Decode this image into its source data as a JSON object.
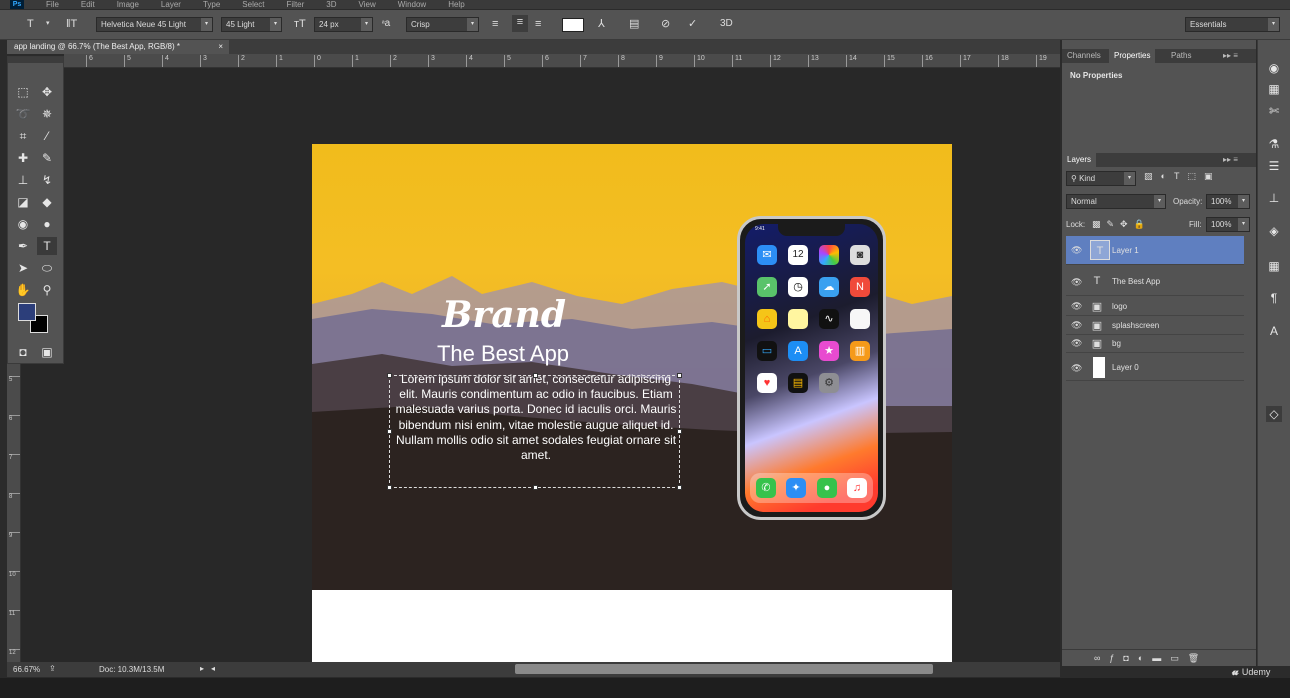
{
  "menubar": {
    "items": [
      "File",
      "Edit",
      "Image",
      "Layer",
      "Type",
      "Select",
      "Filter",
      "3D",
      "View",
      "Window",
      "Help"
    ]
  },
  "options": {
    "font_family": "Helvetica Neue 45 Light",
    "font_style": "45 Light",
    "font_size": "24 px",
    "aa_label": "a",
    "antialias": "Crisp",
    "three_d": "3D",
    "workspace": "Essentials"
  },
  "document": {
    "tab_title": "app landing @ 66.7% (The Best App, RGB/8) *",
    "close": "×"
  },
  "ruler_ticks": [
    "6",
    "5",
    "4",
    "3",
    "2",
    "1",
    "0",
    "1",
    "2",
    "3",
    "4",
    "5",
    "6",
    "7",
    "8",
    "9",
    "10",
    "11",
    "12",
    "13",
    "14",
    "15",
    "16",
    "17",
    "18",
    "19"
  ],
  "ruler_v_ticks": [
    "5",
    "6",
    "7",
    "8",
    "9",
    "10",
    "11",
    "12",
    "13"
  ],
  "canvas": {
    "brand": "Brand",
    "headline": "The Best App",
    "body_lines": [
      "Lorem ipsum dolor sit amet, consectetur adipiscing",
      "elit. Mauris condimentum ac odio in faucibus. Etiam",
      "malesuada varius porta. Donec id iaculis orci. Mauris",
      "bibendum nisi enim, vitae molestie augue aliquet id.",
      "Nullam mollis odio sit amet sodales feugiat ornare sit",
      "amet."
    ],
    "phone_time": "9:41",
    "calendar_day": "12",
    "app_labels": [
      "Mail",
      "Calendar",
      "Photos",
      "Camera",
      "Maps",
      "Clock",
      "Weather",
      "News",
      "Home",
      "Notes",
      "Stocks",
      "Reminders",
      "TV",
      "App Store",
      "iTunes",
      "iBooks",
      "Health",
      "Wallet",
      "Settings"
    ]
  },
  "panels": {
    "tabs": [
      "Channels",
      "Properties",
      "Paths"
    ],
    "properties_text": "No Properties",
    "layers_tab": "Layers",
    "kind": "Kind",
    "blend_mode": "Normal",
    "opacity_label": "Opacity:",
    "opacity_value": "100%",
    "lock_label": "Lock:",
    "fill_label": "Fill:",
    "fill_value": "100%",
    "layers": [
      {
        "name": "Layer 1",
        "type": "T",
        "selected": true
      },
      {
        "name": "The Best App",
        "type": "T",
        "selected": false
      },
      {
        "name": "logo",
        "type": "smart",
        "selected": false
      },
      {
        "name": "splashscreen",
        "type": "smart",
        "selected": false
      },
      {
        "name": "bg",
        "type": "smart",
        "selected": false
      },
      {
        "name": "Layer 0",
        "type": "white",
        "selected": false
      }
    ]
  },
  "status": {
    "zoom": "66.67%",
    "doc_size": "Doc: 10.3M/13.5M"
  },
  "watermark": "Udemy",
  "colors": {
    "panel": "#535353",
    "canvas": "#282828",
    "selected_layer": "#5f7fc0",
    "sky": "#f1bc1c",
    "foreground": "#2c3e7a"
  }
}
